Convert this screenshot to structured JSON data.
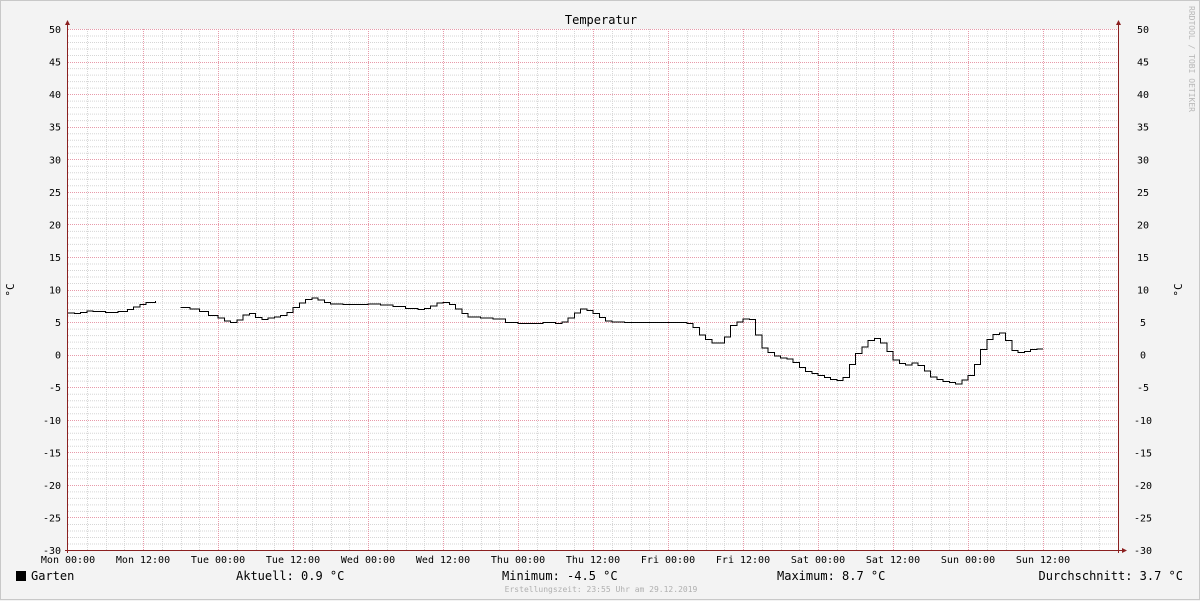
{
  "chart_data": {
    "type": "line",
    "title": "Temperatur",
    "ylabel": "°C",
    "ylim": [
      -30,
      50
    ],
    "ytick_step": 5,
    "xlim": [
      0,
      168
    ],
    "x_unit": "hours since Mon 00:00",
    "xtick_labels": [
      "Mon 00:00",
      "Mon 12:00",
      "Tue 00:00",
      "Tue 12:00",
      "Wed 00:00",
      "Wed 12:00",
      "Thu 00:00",
      "Thu 12:00",
      "Fri 00:00",
      "Fri 12:00",
      "Sat 00:00",
      "Sat 12:00",
      "Sun 00:00",
      "Sun 12:00"
    ],
    "grid": true,
    "series": [
      {
        "name": "Garten",
        "color": "#000000",
        "segments": [
          [
            [
              0,
              6.4
            ],
            [
              1,
              6.3
            ],
            [
              2,
              6.5
            ],
            [
              3,
              6.7
            ],
            [
              4,
              6.6
            ],
            [
              6,
              6.5
            ],
            [
              8,
              6.6
            ],
            [
              9.5,
              6.9
            ],
            [
              10.5,
              7.3
            ],
            [
              11.5,
              7.7
            ],
            [
              12.5,
              8.0
            ],
            [
              14,
              8.2
            ]
          ],
          [
            [
              18,
              7.2
            ],
            [
              19.5,
              7.0
            ],
            [
              21,
              6.6
            ],
            [
              22.5,
              6.0
            ],
            [
              24,
              5.6
            ],
            [
              25,
              5.2
            ],
            [
              26,
              4.9
            ],
            [
              27,
              5.3
            ],
            [
              28,
              6.1
            ],
            [
              29,
              6.3
            ],
            [
              30,
              5.7
            ],
            [
              31,
              5.4
            ],
            [
              32,
              5.6
            ],
            [
              33,
              5.8
            ],
            [
              34,
              6.0
            ],
            [
              35,
              6.5
            ],
            [
              36,
              7.2
            ],
            [
              37,
              7.9
            ],
            [
              38,
              8.5
            ],
            [
              39,
              8.7
            ],
            [
              40,
              8.4
            ],
            [
              41,
              8.0
            ],
            [
              42,
              7.8
            ],
            [
              44,
              7.7
            ],
            [
              46,
              7.7
            ],
            [
              48,
              7.8
            ],
            [
              50,
              7.6
            ],
            [
              52,
              7.4
            ],
            [
              54,
              7.1
            ],
            [
              56,
              6.9
            ],
            [
              57,
              7.1
            ],
            [
              58,
              7.5
            ],
            [
              59,
              7.9
            ],
            [
              60,
              8.0
            ],
            [
              61,
              7.7
            ],
            [
              62,
              7.0
            ],
            [
              63,
              6.3
            ],
            [
              64,
              5.8
            ],
            [
              66,
              5.6
            ],
            [
              68,
              5.5
            ],
            [
              70,
              4.9
            ],
            [
              72,
              4.8
            ],
            [
              74,
              4.8
            ],
            [
              76,
              4.9
            ],
            [
              78,
              4.8
            ],
            [
              79,
              5.0
            ],
            [
              80,
              5.6
            ],
            [
              81,
              6.4
            ],
            [
              82,
              7.0
            ],
            [
              83,
              6.8
            ],
            [
              84,
              6.3
            ],
            [
              85,
              5.7
            ],
            [
              86,
              5.2
            ],
            [
              87,
              5.0
            ],
            [
              89,
              4.9
            ],
            [
              91,
              4.9
            ],
            [
              93,
              4.9
            ],
            [
              95,
              4.9
            ],
            [
              97,
              4.9
            ],
            [
              99,
              4.8
            ],
            [
              100,
              4.2
            ],
            [
              101,
              3.0
            ],
            [
              102,
              2.3
            ],
            [
              103,
              1.8
            ],
            [
              104,
              1.8
            ],
            [
              105,
              2.7
            ],
            [
              106,
              4.5
            ],
            [
              107,
              5.0
            ],
            [
              108,
              5.5
            ],
            [
              109,
              5.4
            ],
            [
              110,
              3.0
            ],
            [
              111,
              1.0
            ],
            [
              112,
              0.3
            ],
            [
              113,
              -0.2
            ],
            [
              114,
              -0.5
            ],
            [
              115,
              -0.7
            ],
            [
              116,
              -1.2
            ],
            [
              117,
              -2.0
            ],
            [
              118,
              -2.6
            ],
            [
              119,
              -2.9
            ],
            [
              120,
              -3.2
            ],
            [
              121,
              -3.5
            ],
            [
              122,
              -3.8
            ],
            [
              123,
              -4.0
            ],
            [
              124,
              -3.5
            ],
            [
              125,
              -1.5
            ],
            [
              126,
              0.2
            ],
            [
              127,
              1.2
            ],
            [
              128,
              2.2
            ],
            [
              129,
              2.5
            ],
            [
              130,
              1.8
            ],
            [
              131,
              0.5
            ],
            [
              132,
              -0.8
            ],
            [
              133,
              -1.4
            ],
            [
              134,
              -1.6
            ],
            [
              135,
              -1.3
            ],
            [
              136,
              -1.7
            ],
            [
              137,
              -2.5
            ],
            [
              138,
              -3.4
            ],
            [
              139,
              -3.8
            ],
            [
              140,
              -4.1
            ],
            [
              141,
              -4.3
            ],
            [
              142,
              -4.5
            ],
            [
              143,
              -3.9
            ],
            [
              144,
              -3.2
            ],
            [
              145,
              -1.5
            ],
            [
              146,
              0.8
            ],
            [
              147,
              2.3
            ],
            [
              148,
              3.1
            ],
            [
              149,
              3.3
            ],
            [
              150,
              2.2
            ],
            [
              151,
              0.6
            ],
            [
              152,
              0.3
            ],
            [
              153,
              0.5
            ],
            [
              154,
              0.8
            ],
            [
              155,
              0.9
            ],
            [
              156,
              0.9
            ]
          ]
        ]
      }
    ]
  },
  "legend": {
    "series_name": "Garten",
    "current": "Aktuell: 0.9 °C",
    "minimum": "Minimum: -4.5 °C",
    "maximum": "Maximum: 8.7 °C",
    "average": "Durchschnitt: 3.7 °C"
  },
  "footer": {
    "created": "Erstellungszeit: 23:55 Uhr am 29.12.2019"
  },
  "watermark": "RRDTOOL / TOBI OETIKER",
  "colors": {
    "background": "#f3f3f3",
    "plot_background": "#ffffff",
    "major_grid": "#e89aaa",
    "minor_grid": "#d6d6d6",
    "axis": "#8b2020",
    "line": "#000000"
  }
}
